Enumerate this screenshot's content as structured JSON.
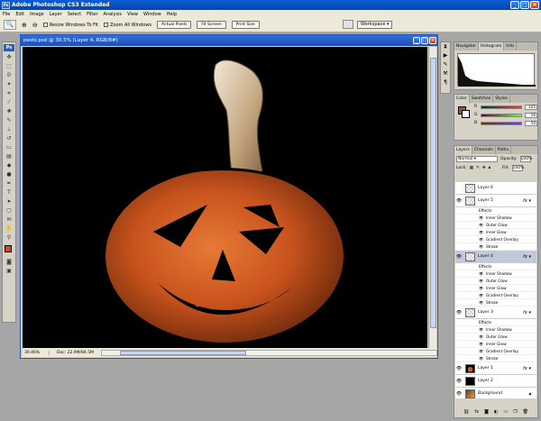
{
  "title": "Adobe Photoshop CS3 Extended",
  "title_icon": "Ps",
  "menu": [
    "File",
    "Edit",
    "Image",
    "Layer",
    "Select",
    "Filter",
    "Analysis",
    "View",
    "Window",
    "Help"
  ],
  "options": {
    "resize_windows": "Resize Windows To Fit",
    "zoom_all": "Zoom All Windows",
    "actual_pixels": "Actual Pixels",
    "fit_screen": "Fit Screen",
    "print_size": "Print Size",
    "workspace": "Workspace"
  },
  "toolbox": {
    "logo": "Ps"
  },
  "document": {
    "title": "pests.psd @ 30.5% (Layer 4, RGB/8#)",
    "zoom": "30.46%",
    "doc_size": "Doc: 22.9M/84.5M"
  },
  "panels": {
    "top_tabs": [
      "Navigator",
      "Histogram",
      "Info"
    ],
    "color_tabs": [
      "Color",
      "Swatches",
      "Styles"
    ],
    "color": {
      "r_label": "R",
      "g_label": "G",
      "b_label": "B",
      "r": "105",
      "g": "56",
      "b": "50"
    },
    "layer_tabs": [
      "Layers",
      "Channels",
      "Paths"
    ],
    "blend_mode": "Normal",
    "opacity_label": "Opacity:",
    "opacity": "100%",
    "lock_label": "Lock:",
    "fill_label": "Fill:",
    "fill": "100%"
  },
  "layers": [
    {
      "name": "Layer 6",
      "thumb": "checker",
      "fx": false,
      "selected": false,
      "effects": []
    },
    {
      "name": "Layer 5",
      "thumb": "checker",
      "fx": true,
      "selected": false,
      "effects": [
        "Effects",
        "Inner Shadow",
        "Outer Glow",
        "Inner Glow",
        "Gradient Overlay",
        "Stroke"
      ]
    },
    {
      "name": "Layer 4",
      "thumb": "checker",
      "fx": true,
      "selected": true,
      "effects": [
        "Effects",
        "Inner Shadow",
        "Outer Glow",
        "Inner Glow",
        "Gradient Overlay",
        "Stroke"
      ]
    },
    {
      "name": "Layer 3",
      "thumb": "checker",
      "fx": true,
      "selected": false,
      "effects": [
        "Effects",
        "Inner Shadow",
        "Outer Glow",
        "Inner Glow",
        "Gradient Overlay",
        "Stroke"
      ]
    },
    {
      "name": "Layer 1",
      "thumb": "pumpkin",
      "fx": true,
      "selected": false,
      "effects": []
    },
    {
      "name": "Layer 2",
      "thumb": "dark",
      "fx": false,
      "selected": false,
      "effects": []
    },
    {
      "name": "Background",
      "thumb": "photo",
      "fx": false,
      "selected": false,
      "effects": []
    }
  ],
  "colors": {
    "accent": "#1d4fb8",
    "pumpkin": "#c8531d",
    "canvas": "#000000"
  }
}
